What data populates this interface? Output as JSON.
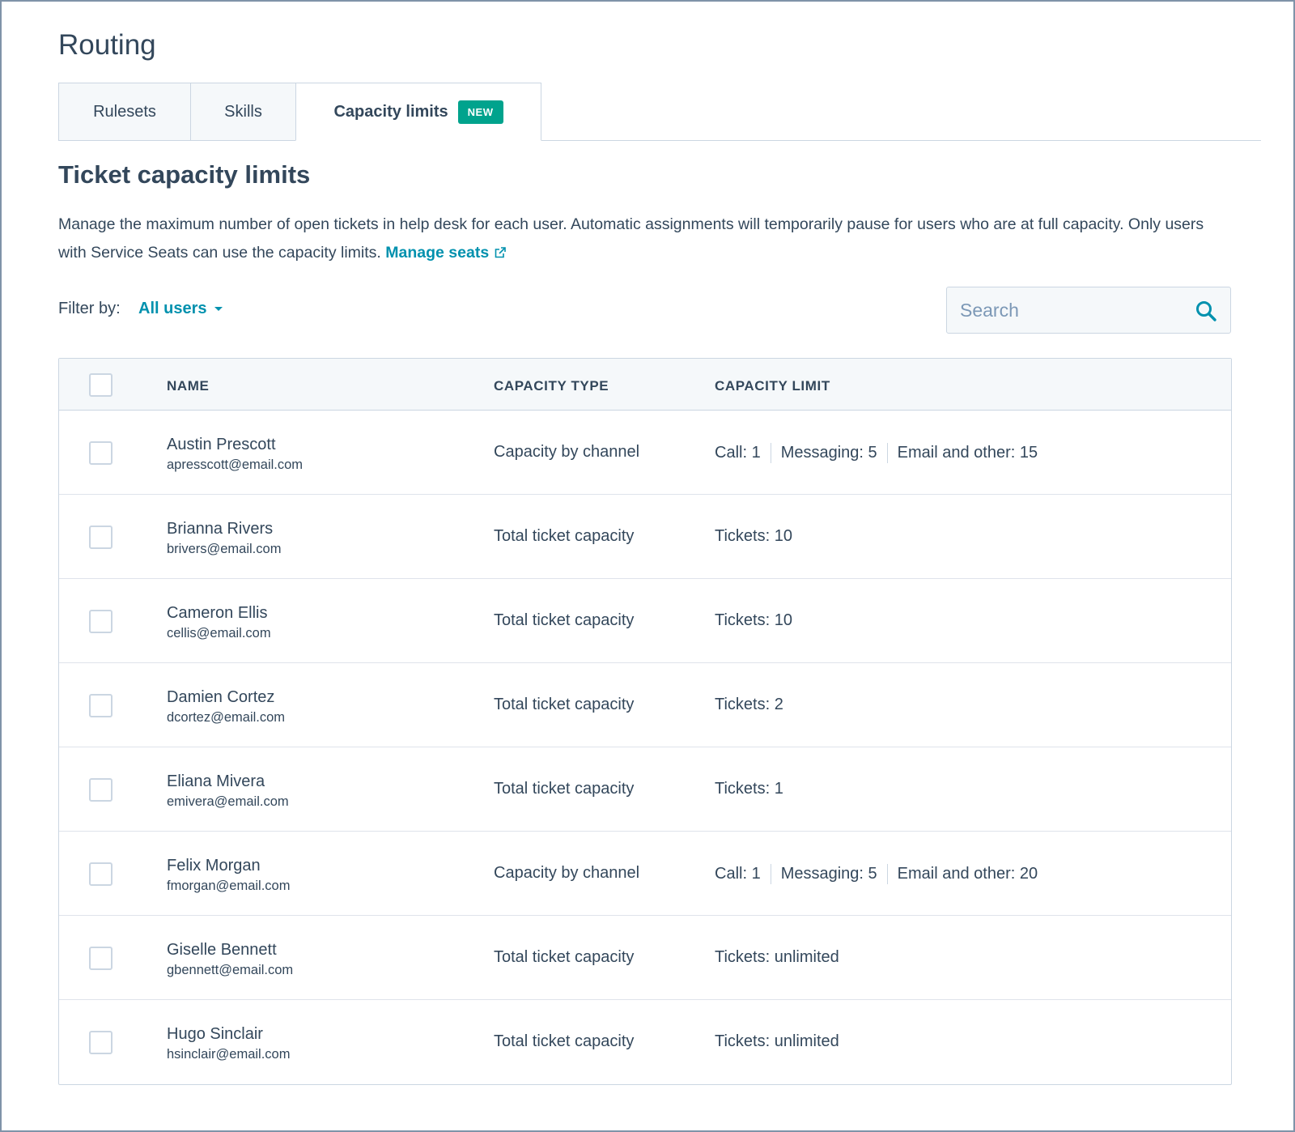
{
  "page": {
    "title": "Routing"
  },
  "tabs": [
    {
      "label": "Rulesets",
      "active": false
    },
    {
      "label": "Skills",
      "active": false
    },
    {
      "label": "Capacity limits",
      "active": true,
      "badge": "NEW"
    }
  ],
  "section": {
    "title": "Ticket capacity limits",
    "description": "Manage the maximum number of open tickets in help desk for each user. Automatic assignments will temporarily pause for users who are at full capacity. Only users with Service Seats can use the capacity limits.",
    "link_label": "Manage seats"
  },
  "filter": {
    "label": "Filter by:",
    "value": "All users"
  },
  "search": {
    "placeholder": "Search"
  },
  "table": {
    "headers": {
      "name": "NAME",
      "capacity_type": "CAPACITY TYPE",
      "capacity_limit": "CAPACITY LIMIT"
    },
    "rows": [
      {
        "name": "Austin Prescott",
        "email": "apresscott@email.com",
        "capacity_type": "Capacity by channel",
        "limits": [
          "Call: 1",
          "Messaging: 5",
          "Email and other: 15"
        ]
      },
      {
        "name": "Brianna Rivers",
        "email": "brivers@email.com",
        "capacity_type": "Total ticket capacity",
        "limits": [
          "Tickets: 10"
        ]
      },
      {
        "name": "Cameron Ellis",
        "email": "cellis@email.com",
        "capacity_type": "Total ticket capacity",
        "limits": [
          "Tickets: 10"
        ]
      },
      {
        "name": "Damien Cortez",
        "email": "dcortez@email.com",
        "capacity_type": "Total ticket capacity",
        "limits": [
          "Tickets: 2"
        ]
      },
      {
        "name": "Eliana Mivera",
        "email": "emivera@email.com",
        "capacity_type": "Total ticket capacity",
        "limits": [
          "Tickets: 1"
        ]
      },
      {
        "name": "Felix Morgan",
        "email": "fmorgan@email.com",
        "capacity_type": "Capacity by channel",
        "limits": [
          "Call: 1",
          "Messaging: 5",
          "Email and other: 20"
        ]
      },
      {
        "name": "Giselle Bennett",
        "email": "gbennett@email.com",
        "capacity_type": "Total ticket capacity",
        "limits": [
          "Tickets: unlimited"
        ]
      },
      {
        "name": "Hugo Sinclair",
        "email": "hsinclair@email.com",
        "capacity_type": "Total ticket capacity",
        "limits": [
          "Tickets: unlimited"
        ]
      }
    ]
  },
  "colors": {
    "accent": "#0091ae",
    "badge": "#00a38d",
    "text": "#33475b",
    "border": "#cbd6e2",
    "header_bg": "#f5f8fa"
  },
  "icons": {
    "search": "search-icon",
    "external_link": "external-link-icon",
    "filter_caret": "caret-down-icon"
  }
}
